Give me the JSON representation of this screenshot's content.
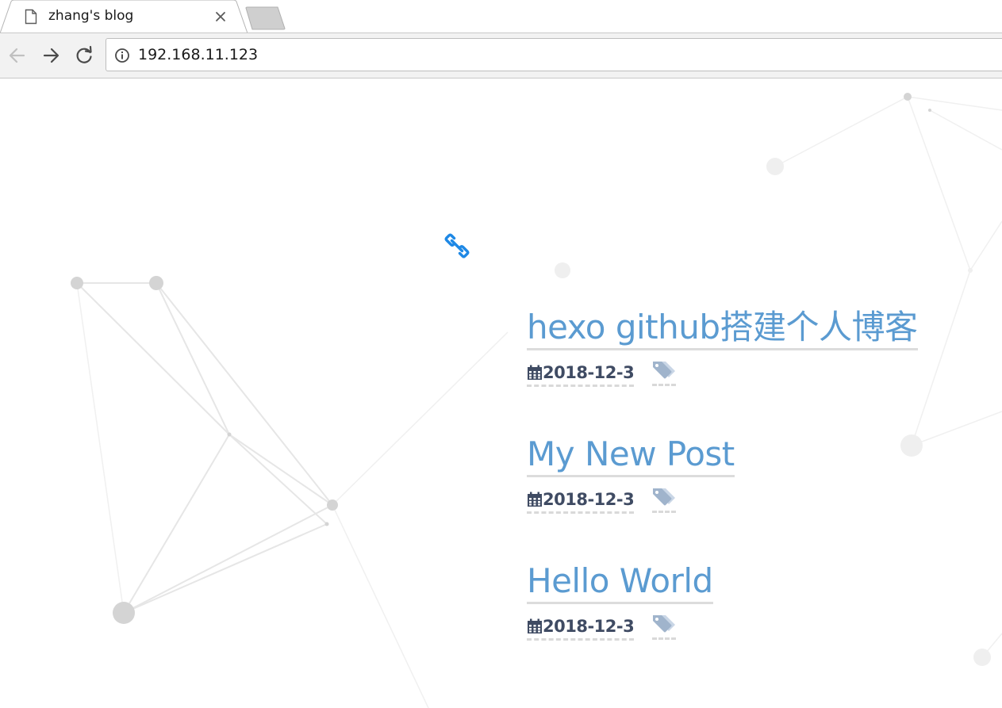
{
  "browser": {
    "tab": {
      "title": "zhang's blog",
      "page_icon": "document-icon",
      "close_icon": "close-icon"
    },
    "new_tab_icon": "new-tab-icon",
    "toolbar": {
      "back_icon": "back-arrow-icon",
      "forward_icon": "forward-arrow-icon",
      "reload_icon": "reload-icon",
      "info_icon": "info-icon",
      "url": "192.168.11.123"
    }
  },
  "page": {
    "link_icon": "link-icon",
    "posts": [
      {
        "title": "hexo github搭建个人博客",
        "date": "2018-12-3",
        "date_icon": "calendar-icon",
        "tag_icon": "tags-icon"
      },
      {
        "title": "My New Post",
        "date": "2018-12-3",
        "date_icon": "calendar-icon",
        "tag_icon": "tags-icon"
      },
      {
        "title": "Hello World",
        "date": "2018-12-3",
        "date_icon": "calendar-icon",
        "tag_icon": "tags-icon"
      }
    ],
    "colors": {
      "title": "#5b9bd1",
      "date": "#3f4b63",
      "tag": "#a0b4cc",
      "link": "#1e88e5"
    }
  }
}
